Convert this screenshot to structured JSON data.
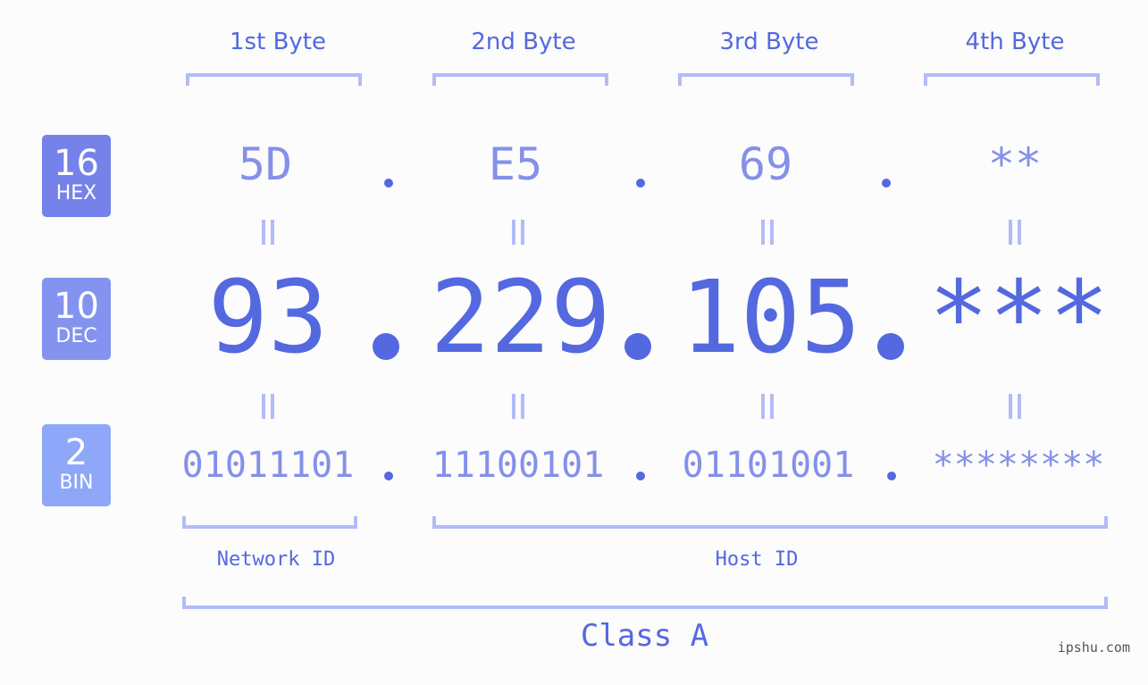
{
  "colors": {
    "hex_badge": "#7482e9",
    "dec_badge": "#8393ef",
    "bin_badge": "#8fa7f8",
    "accent": "#5468e0",
    "muted": "#8490ea",
    "bracket": "#b3bbf7"
  },
  "byte_headers": [
    "1st Byte",
    "2nd Byte",
    "3rd Byte",
    "4th Byte"
  ],
  "badges": {
    "hex": {
      "num": "16",
      "label": "HEX"
    },
    "dec": {
      "num": "10",
      "label": "DEC"
    },
    "bin": {
      "num": "2",
      "label": "BIN"
    }
  },
  "hex_values": [
    "5D",
    "E5",
    "69",
    "**"
  ],
  "dec_values": [
    "93",
    "229",
    "105",
    "***"
  ],
  "bin_values": [
    "01011101",
    "11100101",
    "01101001",
    "********"
  ],
  "network_label": "Network ID",
  "host_label": "Host ID",
  "class_label": "Class A",
  "footer": "ipshu.com"
}
